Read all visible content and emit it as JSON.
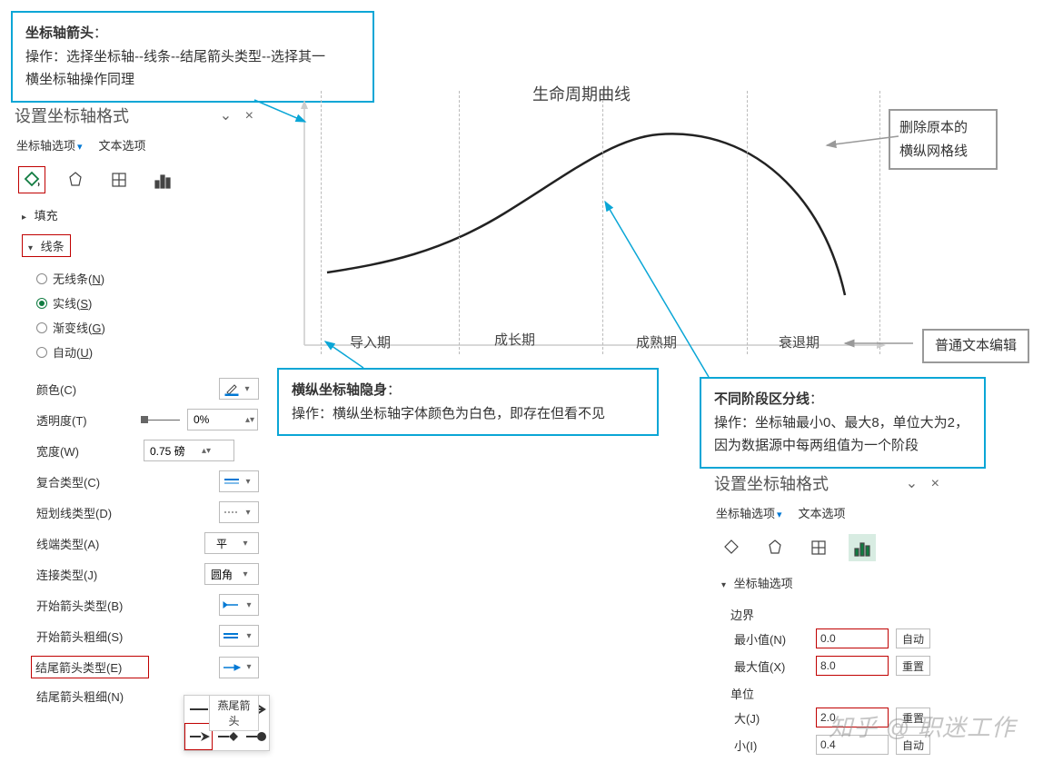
{
  "callouts": {
    "c1": {
      "title": "坐标轴箭头",
      "sep": "：",
      "l1": "操作：选择坐标轴--线条--结尾箭头类型--选择其一",
      "l2": "横坐标轴操作同理"
    },
    "c2": {
      "l1": "删除原本的",
      "l2": "横纵网格线"
    },
    "c3": {
      "label": "普通文本编辑"
    },
    "c4": {
      "title": "横纵坐标轴隐身",
      "sep": "：",
      "l1": "操作：横纵坐标轴字体颜色为白色，即存在但看不见"
    },
    "c5": {
      "title": "不同阶段区分线",
      "sep": "：",
      "l1": "操作：坐标轴最小0、最大8，单位大为2，",
      "l2": "因为数据源中每两组值为一个阶段"
    }
  },
  "chart": {
    "title": "生命周期曲线",
    "x_categories": [
      "导入期",
      "成长期",
      "成熟期",
      "衰退期"
    ]
  },
  "chart_data": {
    "type": "line",
    "title": "生命周期曲线",
    "xlabel": "",
    "ylabel": "",
    "x": [
      0,
      1,
      2,
      3,
      4,
      5,
      6,
      7,
      8
    ],
    "values": [
      1.0,
      1.2,
      1.6,
      2.6,
      3.6,
      4.1,
      4.0,
      3.2,
      1.3
    ],
    "xlim": [
      0,
      8
    ],
    "ylim": [
      0,
      5
    ],
    "phase_labels": [
      "导入期",
      "成长期",
      "成熟期",
      "衰退期"
    ],
    "phase_dividers": [
      2,
      4,
      6
    ]
  },
  "left_panel": {
    "title": "设置坐标轴格式",
    "tab1": "坐标轴选项",
    "tab2": "文本选项",
    "sec_fill": "填充",
    "sec_line": "线条",
    "radios": {
      "none": "无线条(",
      "none_k": "N",
      "none_s": ")",
      "solid": "实线(",
      "solid_k": "S",
      "solid_s": ")",
      "grad": "渐变线(",
      "grad_k": "G",
      "grad_s": ")",
      "auto": "自动(",
      "auto_k": "U",
      "auto_s": ")"
    },
    "props": {
      "color": "颜色(C)",
      "opacity": "透明度(T)",
      "opacity_val": "0%",
      "width": "宽度(W)",
      "width_val": "0.75 磅",
      "compound": "复合类型(C)",
      "dash": "短划线类型(D)",
      "cap": "线端类型(A)",
      "cap_val": "平",
      "join": "连接类型(J)",
      "join_val": "圆角",
      "begin_arrow": "开始箭头类型(B)",
      "begin_size": "开始箭头粗细(S)",
      "end_arrow": "结尾箭头类型(E)",
      "end_size": "结尾箭头粗细(N)"
    },
    "arrow_tooltip": "燕尾箭头"
  },
  "right_panel": {
    "title": "设置坐标轴格式",
    "tab1": "坐标轴选项",
    "tab2": "文本选项",
    "section": "坐标轴选项",
    "bounds": "边界",
    "min_label": "最小值(N)",
    "min_val": "0.0",
    "max_label": "最大值(X)",
    "max_val": "8.0",
    "btn_auto": "自动",
    "btn_reset": "重置",
    "unit": "单位",
    "major_label": "大(J)",
    "major_val": "2.0",
    "minor_label": "小(I)",
    "minor_val": "0.4"
  },
  "watermark": "知乎 @ 职迷工作"
}
